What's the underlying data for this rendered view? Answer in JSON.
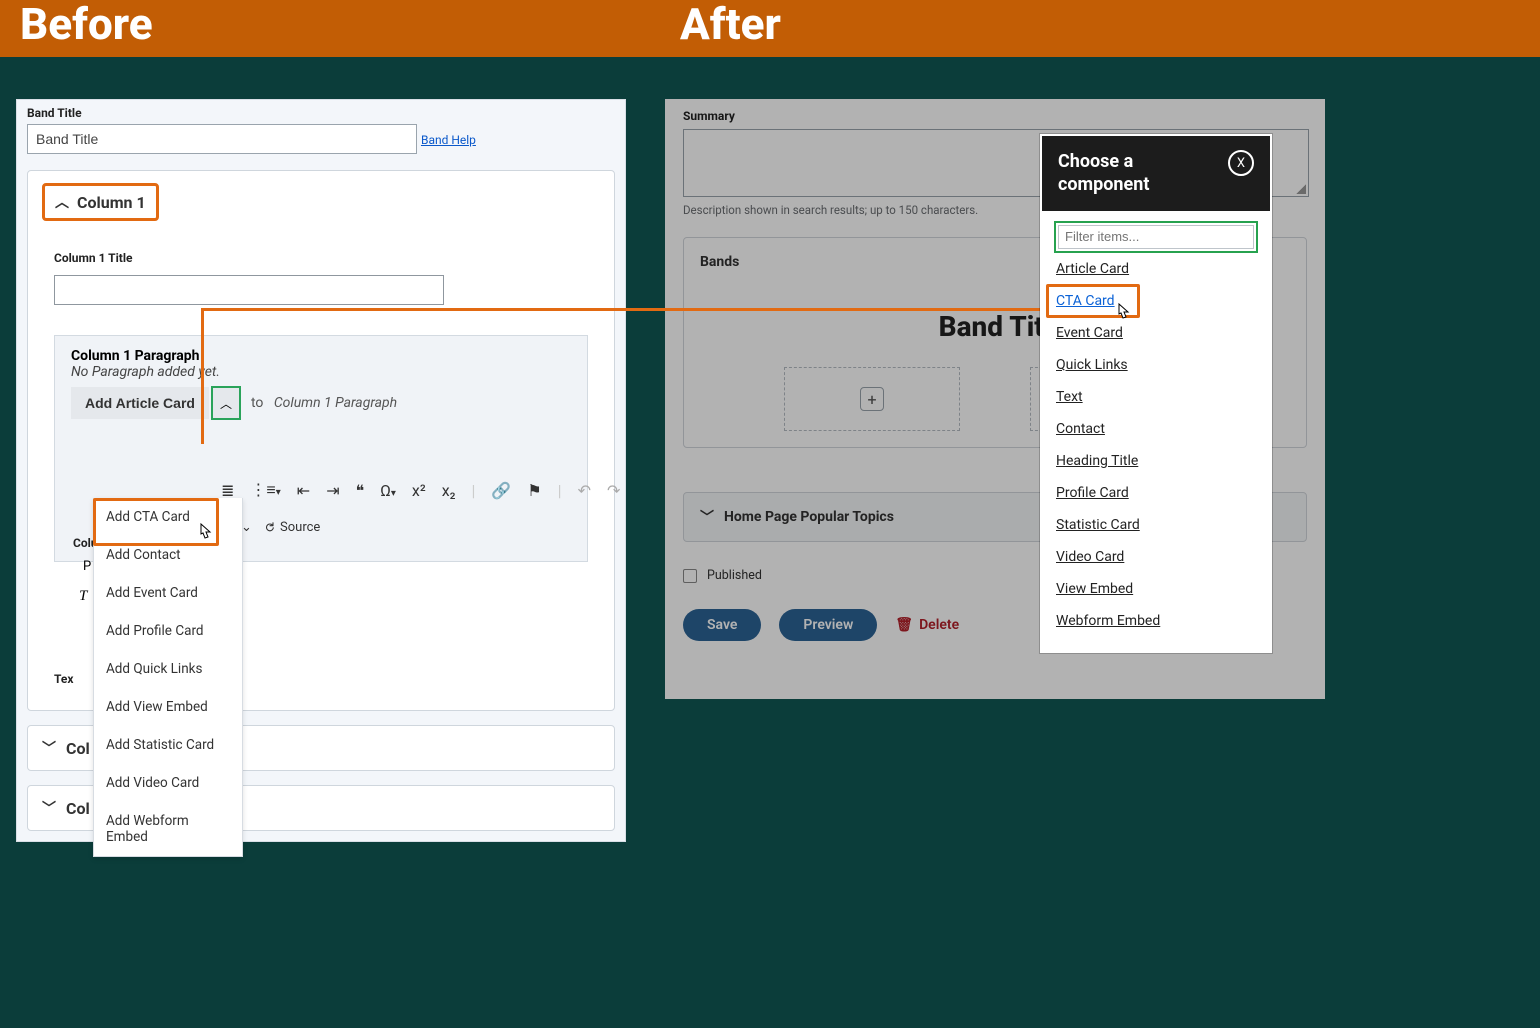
{
  "header": {
    "before": "Before",
    "after": "After"
  },
  "before": {
    "band_title_label": "Band Title",
    "band_title_value": "Band Title",
    "band_help_link": "Band Help",
    "column1_header": "Column 1",
    "column1_title_label": "Column 1 Title",
    "column1_title_value": "",
    "c1_para_title": "Column 1 Paragraph",
    "c1_para_sub": "No Paragraph added yet.",
    "add_article_btn": "Add Article Card",
    "to_text": "to",
    "to_target": "Column 1 Paragraph",
    "dropdown_items": {
      "cta": "Add CTA Card",
      "contact": "Add Contact",
      "event": "Add Event Card",
      "profile": "Add Profile Card",
      "quicklinks": "Add Quick Links",
      "viewembed": "Add View Embed",
      "statistic": "Add Statistic Card",
      "video": "Add Video Card",
      "webform": "Add Webform Embed"
    },
    "toolbar_source": "Source",
    "tex_label": "Tex",
    "col_partial": "Col",
    "p_partial": "P",
    "t_partial": "T",
    "colu_partial": "Colu"
  },
  "after": {
    "summary_label": "Summary",
    "summary_help": "Description shown in search results; up to 150 characters.",
    "bands_label": "Bands",
    "band_heading": "Band Titl",
    "topics_label": "Home Page Popular Topics",
    "published_label": "Published",
    "save_btn": "Save",
    "preview_btn": "Preview",
    "delete_link": "Delete"
  },
  "modal": {
    "title": "Choose a component",
    "close": "X",
    "filter_placeholder": "Filter items...",
    "items": {
      "article": "Article Card",
      "cta": "CTA Card",
      "event": "Event Card",
      "quicklinks": "Quick Links",
      "text": "Text",
      "contact": "Contact",
      "heading": "Heading Title",
      "profile": "Profile Card",
      "statistic": "Statistic Card",
      "video": "Video Card",
      "viewembed": "View Embed",
      "webform": "Webform Embed"
    }
  }
}
